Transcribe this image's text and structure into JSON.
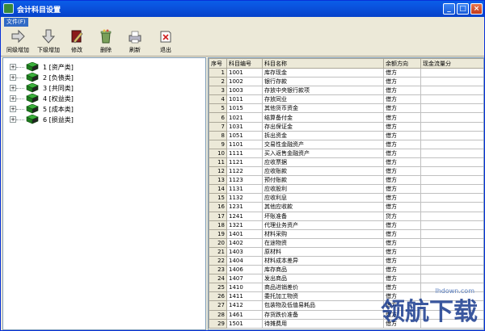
{
  "window": {
    "title": "会计科目设置"
  },
  "titlebar_buttons": [
    "_",
    "□",
    "×"
  ],
  "menu": {
    "items": [
      "文件(F)"
    ]
  },
  "toolbar": {
    "buttons": [
      {
        "label": "同级增加",
        "icon": "arrow-right-icon"
      },
      {
        "label": "下级增加",
        "icon": "arrow-down-icon"
      },
      {
        "label": "修改",
        "icon": "book-edit-icon"
      },
      {
        "label": "删除",
        "icon": "recycle-bin-icon"
      },
      {
        "label": "刷新",
        "icon": "printer-refresh-icon"
      },
      {
        "label": "退出",
        "icon": "exit-icon"
      }
    ]
  },
  "tree": {
    "items": [
      {
        "label": "1 [资产类]"
      },
      {
        "label": "2 [负债类]"
      },
      {
        "label": "3 [共同类]"
      },
      {
        "label": "4 [权益类]"
      },
      {
        "label": "5 [成本类]"
      },
      {
        "label": "6 [损益类]"
      }
    ]
  },
  "table": {
    "headers": [
      "序号",
      "科目编号",
      "科目名称",
      "余额方向",
      "现金流量分"
    ],
    "rows": [
      [
        "1",
        "1001",
        "库存现金",
        "借方",
        ""
      ],
      [
        "2",
        "1002",
        "银行存款",
        "借方",
        ""
      ],
      [
        "3",
        "1003",
        "存放中央银行款项",
        "借方",
        ""
      ],
      [
        "4",
        "1011",
        "存放同业",
        "借方",
        ""
      ],
      [
        "5",
        "1015",
        "其他货币资金",
        "借方",
        ""
      ],
      [
        "6",
        "1021",
        "结算备付金",
        "借方",
        ""
      ],
      [
        "7",
        "1031",
        "存出保证金",
        "借方",
        ""
      ],
      [
        "8",
        "1051",
        "拆出资金",
        "借方",
        ""
      ],
      [
        "9",
        "1101",
        "交易性金融资产",
        "借方",
        ""
      ],
      [
        "10",
        "1111",
        "买入返售金融资产",
        "借方",
        ""
      ],
      [
        "11",
        "1121",
        "应收票据",
        "借方",
        ""
      ],
      [
        "12",
        "1122",
        "应收账款",
        "借方",
        ""
      ],
      [
        "13",
        "1123",
        "预付账款",
        "借方",
        ""
      ],
      [
        "14",
        "1131",
        "应收股利",
        "借方",
        ""
      ],
      [
        "15",
        "1132",
        "应收利息",
        "借方",
        ""
      ],
      [
        "16",
        "1231",
        "其他应收款",
        "借方",
        ""
      ],
      [
        "17",
        "1241",
        "坏账准备",
        "贷方",
        ""
      ],
      [
        "18",
        "1321",
        "代理业务资产",
        "借方",
        ""
      ],
      [
        "19",
        "1401",
        "材料采购",
        "借方",
        ""
      ],
      [
        "20",
        "1402",
        "在途物资",
        "借方",
        ""
      ],
      [
        "21",
        "1403",
        "原材料",
        "借方",
        ""
      ],
      [
        "22",
        "1404",
        "材料成本差异",
        "借方",
        ""
      ],
      [
        "23",
        "1406",
        "库存商品",
        "借方",
        ""
      ],
      [
        "24",
        "1407",
        "发出商品",
        "借方",
        ""
      ],
      [
        "25",
        "1410",
        "商品进销差价",
        "借方",
        ""
      ],
      [
        "26",
        "1411",
        "委托加工物资",
        "借方",
        ""
      ],
      [
        "27",
        "1412",
        "包装物及低值易耗品",
        "借方",
        ""
      ],
      [
        "28",
        "1461",
        "存货跌价准备",
        "借方",
        ""
      ],
      [
        "29",
        "1501",
        "待摊费用",
        "借方",
        ""
      ]
    ]
  },
  "watermark": {
    "text": "领航下载",
    "url": "lhdown.com"
  },
  "colors": {
    "titlebar": "#0a53df",
    "menu_highlight": "#316ac5",
    "book_green": "#2e8b2e"
  }
}
